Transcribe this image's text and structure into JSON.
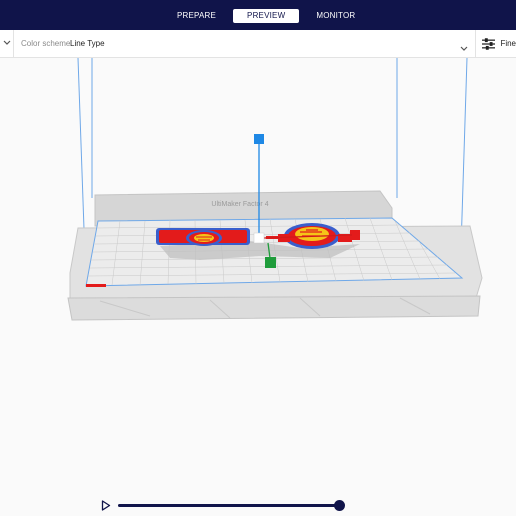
{
  "stages": [
    {
      "label": "PREPARE",
      "active": false
    },
    {
      "label": "PREVIEW",
      "active": true
    },
    {
      "label": "MONITOR",
      "active": false
    }
  ],
  "view_options": {
    "color_scheme_label": "Color scheme",
    "color_scheme_value": "Line Type"
  },
  "print_settings": {
    "profile_label": "Fine"
  },
  "build_plate": {
    "printer_name": "UltiMaker Factor 4"
  },
  "simulation": {
    "layer_progress": 1.0
  },
  "colors": {
    "header_bg": "#10144a",
    "model_wall": "#e31b1b",
    "infill": "#f5c518",
    "skin": "#3a5fcd",
    "gizmo_x": "#d11a1a",
    "gizmo_y": "#1e88e5",
    "gizmo_z": "#1f9c3b"
  }
}
